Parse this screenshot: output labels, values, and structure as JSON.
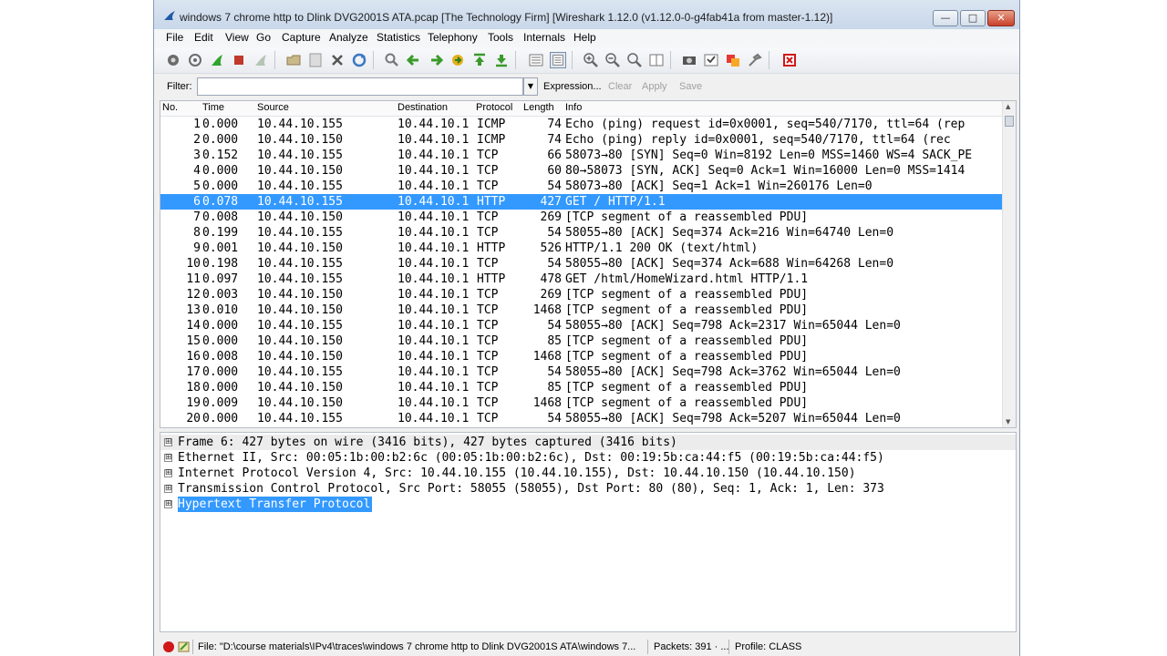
{
  "window": {
    "title": "windows 7 chrome http to Dlink DVG2001S ATA.pcap  [The Technology Firm]  [Wireshark 1.12.0  (v1.12.0-0-g4fab41a from master-1.12)]",
    "min_label": "—",
    "max_label": "□",
    "close_label": "✕"
  },
  "menu": [
    "File",
    "Edit",
    "View",
    "Go",
    "Capture",
    "Analyze",
    "Statistics",
    "Telephony",
    "Tools",
    "Internals",
    "Help"
  ],
  "filter": {
    "label": "Filter:",
    "value": "",
    "expression": "Expression...",
    "clear": "Clear",
    "apply": "Apply",
    "save": "Save"
  },
  "columns": [
    "No.",
    "Time",
    "Source",
    "Destination",
    "Protocol",
    "Length",
    "Info"
  ],
  "packets": [
    {
      "no": "1",
      "time": "0.000",
      "src": "10.44.10.155",
      "dst": "10.44.10.1",
      "proto": "ICMP",
      "len": "74",
      "info": "Echo (ping) request  id=0x0001, seq=540/7170, ttl=64 (rep"
    },
    {
      "no": "2",
      "time": "0.000",
      "src": "10.44.10.150",
      "dst": "10.44.10.1",
      "proto": "ICMP",
      "len": "74",
      "info": "Echo (ping) reply    id=0x0001, seq=540/7170, ttl=64 (rec"
    },
    {
      "no": "3",
      "time": "0.152",
      "src": "10.44.10.155",
      "dst": "10.44.10.1",
      "proto": "TCP",
      "len": "66",
      "info": "58073→80 [SYN] Seq=0 Win=8192 Len=0 MSS=1460 WS=4 SACK_PE"
    },
    {
      "no": "4",
      "time": "0.000",
      "src": "10.44.10.150",
      "dst": "10.44.10.1",
      "proto": "TCP",
      "len": "60",
      "info": "80→58073 [SYN, ACK] Seq=0 Ack=1 Win=16000 Len=0 MSS=1414"
    },
    {
      "no": "5",
      "time": "0.000",
      "src": "10.44.10.155",
      "dst": "10.44.10.1",
      "proto": "TCP",
      "len": "54",
      "info": "58073→80 [ACK] Seq=1 Ack=1 Win=260176 Len=0"
    },
    {
      "no": "6",
      "time": "0.078",
      "src": "10.44.10.155",
      "dst": "10.44.10.1",
      "proto": "HTTP",
      "len": "427",
      "info": "GET / HTTP/1.1"
    },
    {
      "no": "7",
      "time": "0.008",
      "src": "10.44.10.150",
      "dst": "10.44.10.1",
      "proto": "TCP",
      "len": "269",
      "info": "[TCP segment of a reassembled PDU]"
    },
    {
      "no": "8",
      "time": "0.199",
      "src": "10.44.10.155",
      "dst": "10.44.10.1",
      "proto": "TCP",
      "len": "54",
      "info": "58055→80 [ACK] Seq=374 Ack=216 Win=64740 Len=0"
    },
    {
      "no": "9",
      "time": "0.001",
      "src": "10.44.10.150",
      "dst": "10.44.10.1",
      "proto": "HTTP",
      "len": "526",
      "info": "HTTP/1.1 200 OK  (text/html)"
    },
    {
      "no": "10",
      "time": "0.198",
      "src": "10.44.10.155",
      "dst": "10.44.10.1",
      "proto": "TCP",
      "len": "54",
      "info": "58055→80 [ACK] Seq=374 Ack=688 Win=64268 Len=0"
    },
    {
      "no": "11",
      "time": "0.097",
      "src": "10.44.10.155",
      "dst": "10.44.10.1",
      "proto": "HTTP",
      "len": "478",
      "info": "GET /html/HomeWizard.html HTTP/1.1"
    },
    {
      "no": "12",
      "time": "0.003",
      "src": "10.44.10.150",
      "dst": "10.44.10.1",
      "proto": "TCP",
      "len": "269",
      "info": "[TCP segment of a reassembled PDU]"
    },
    {
      "no": "13",
      "time": "0.010",
      "src": "10.44.10.150",
      "dst": "10.44.10.1",
      "proto": "TCP",
      "len": "1468",
      "info": "[TCP segment of a reassembled PDU]"
    },
    {
      "no": "14",
      "time": "0.000",
      "src": "10.44.10.155",
      "dst": "10.44.10.1",
      "proto": "TCP",
      "len": "54",
      "info": "58055→80 [ACK] Seq=798 Ack=2317 Win=65044 Len=0"
    },
    {
      "no": "15",
      "time": "0.000",
      "src": "10.44.10.150",
      "dst": "10.44.10.1",
      "proto": "TCP",
      "len": "85",
      "info": "[TCP segment of a reassembled PDU]"
    },
    {
      "no": "16",
      "time": "0.008",
      "src": "10.44.10.150",
      "dst": "10.44.10.1",
      "proto": "TCP",
      "len": "1468",
      "info": "[TCP segment of a reassembled PDU]"
    },
    {
      "no": "17",
      "time": "0.000",
      "src": "10.44.10.155",
      "dst": "10.44.10.1",
      "proto": "TCP",
      "len": "54",
      "info": "58055→80 [ACK] Seq=798 Ack=3762 Win=65044 Len=0"
    },
    {
      "no": "18",
      "time": "0.000",
      "src": "10.44.10.150",
      "dst": "10.44.10.1",
      "proto": "TCP",
      "len": "85",
      "info": "[TCP segment of a reassembled PDU]"
    },
    {
      "no": "19",
      "time": "0.009",
      "src": "10.44.10.150",
      "dst": "10.44.10.1",
      "proto": "TCP",
      "len": "1468",
      "info": "[TCP segment of a reassembled PDU]"
    },
    {
      "no": "20",
      "time": "0.000",
      "src": "10.44.10.155",
      "dst": "10.44.10.1",
      "proto": "TCP",
      "len": "54",
      "info": "58055→80 [ACK] Seq=798 Ack=5207 Win=65044 Len=0"
    },
    {
      "no": "21",
      "time": "0.000",
      "src": "10.44.10.150",
      "dst": "10.44.10.1",
      "proto": "TCP",
      "len": "85",
      "info": "[TCP segment of a reassembled PDU]"
    }
  ],
  "selected_packet": "6",
  "details": [
    "Frame 6: 427 bytes on wire (3416 bits), 427 bytes captured (3416 bits)",
    "Ethernet II, Src: 00:05:1b:00:b2:6c (00:05:1b:00:b2:6c), Dst: 00:19:5b:ca:44:f5 (00:19:5b:ca:44:f5)",
    "Internet Protocol Version 4, Src: 10.44.10.155 (10.44.10.155), Dst: 10.44.10.150 (10.44.10.150)",
    "Transmission Control Protocol, Src Port: 58055 (58055), Dst Port: 80 (80), Seq: 1, Ack: 1, Len: 373",
    "Hypertext Transfer Protocol"
  ],
  "expander": "⊞",
  "status": {
    "file": "File: \"D:\\course materials\\IPv4\\traces\\windows 7 chrome http to Dlink DVG2001S ATA\\windows 7...",
    "packets": "Packets: 391 · ...",
    "profile": "Profile: CLASS"
  },
  "colors": {
    "selection": "#3399ff",
    "accent_red": "#d01818"
  },
  "toolbar_icons": [
    "interface-list-icon",
    "capture-options-icon",
    "start-capture-icon",
    "stop-capture-icon",
    "restart-capture-icon",
    "open-file-icon",
    "save-file-icon",
    "close-file-icon",
    "reload-icon",
    "find-packet-icon",
    "go-back-icon",
    "go-forward-icon",
    "go-to-packet-icon",
    "go-first-icon",
    "go-last-icon",
    "colorize-icon",
    "auto-scroll-icon",
    "zoom-in-icon",
    "zoom-out-icon",
    "zoom-normal-icon",
    "resize-columns-icon",
    "capture-filters-icon",
    "display-filters-icon",
    "coloring-rules-icon",
    "preferences-icon",
    "help-icon"
  ]
}
